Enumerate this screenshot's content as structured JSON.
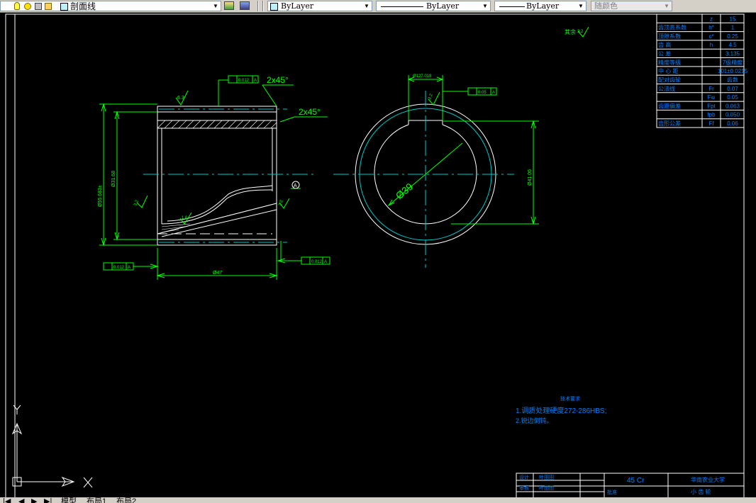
{
  "toolbar": {
    "layer_name": "剖面线",
    "color_label": "ByLayer",
    "linetype_label": "ByLayer",
    "lineweight_label": "ByLayer",
    "plotstyle_label": "随颜色"
  },
  "drawing": {
    "chamfer_note_1": "2x45°",
    "chamfer_note_2": "2x45°",
    "outer_dia": "Ø55.683±",
    "inner_dia": "Ø31.68",
    "length_dim": "Ø47",
    "datum": "A",
    "tol_left": "0.012",
    "tol_top": "0.012",
    "tol_bottom": "0.012",
    "tol_right_view": "0.05",
    "roughness_1": "6.3",
    "roughness_2": "3.2",
    "roughness_3": "3.2",
    "roughness_4": "1.6",
    "roughness_5": "3.2",
    "roughness_6": "3.2",
    "roughness_general": "其余",
    "bore_dia": "Ø39",
    "keyway_width": "Ø127.018",
    "keyway_depth": "Ø41.06",
    "tech_title": "技术要求",
    "tech_line_1": "1.调质处理硬度272-286HBS;",
    "tech_line_2": "2.锐边倒钝。",
    "material": "45 Cr"
  },
  "param_table": {
    "rows": [
      [
        "",
        "z",
        "15"
      ],
      [
        "齿顶高系数",
        "h*",
        "1"
      ],
      [
        "顶隙系数",
        "c*",
        "0.25"
      ],
      [
        "齿 高",
        "h",
        "4.5"
      ],
      [
        "公 差",
        "",
        "3.135"
      ],
      [
        "精度等级",
        "",
        "7级精度"
      ],
      [
        "中 心 距",
        "",
        "101±0.0215"
      ],
      [
        "配对齿轮",
        "",
        "齿数"
      ],
      [
        "公法线",
        "Fr",
        "0.07"
      ],
      [
        "",
        "Fw",
        "0.05"
      ],
      [
        "齿距偏差",
        "Fpt",
        "0.063"
      ],
      [
        "",
        "fpb",
        "0.050"
      ],
      [
        "齿形公差",
        "Ff",
        "0.06"
      ]
    ]
  },
  "title_block": {
    "designer_label": "设计",
    "checker_label": "审核",
    "designer": "叶田田",
    "checker": "叶田田",
    "material": "45 Cr",
    "school": "华南农业大学",
    "approve_label": "批准",
    "part_name": "小 齿 轮"
  },
  "ucs": {
    "x_label": "X",
    "y_label": "Y"
  },
  "tabs": {
    "model": "模型",
    "layout1": "布局1",
    "layout2": "布局2"
  }
}
